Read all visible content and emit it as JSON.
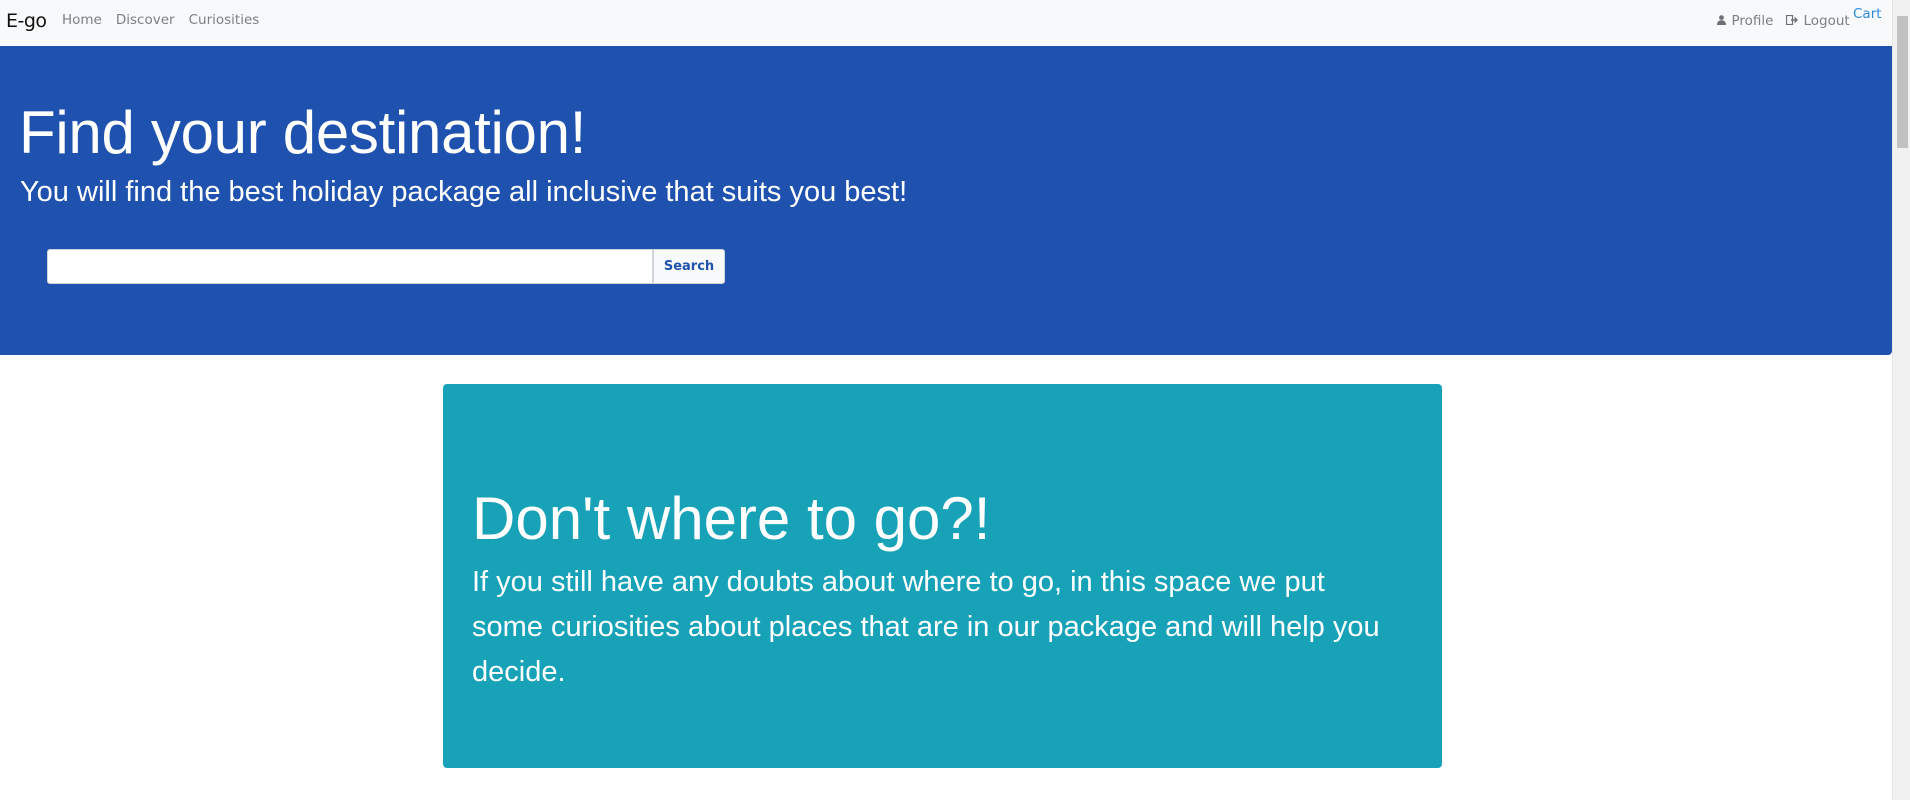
{
  "navbar": {
    "brand": "E-go",
    "links": [
      "Home",
      "Discover",
      "Curiosities"
    ],
    "profile_label": "Profile",
    "logout_label": "Logout",
    "cart_label": "Cart",
    "profile_icon": "user-icon",
    "logout_icon": "sign-out-icon"
  },
  "hero": {
    "title": "Find your destination!",
    "subtitle": "You will find the best holiday package all inclusive that suits you best!",
    "search": {
      "value": "",
      "placeholder": "",
      "button_label": "Search"
    },
    "background_color": "#1e52ae"
  },
  "card": {
    "title": "Don't where to go?!",
    "text": "If you still have any doubts about where to go, in this space we put some curiosities about places that are in our package and will help you decide.",
    "background_color": "#17a2b8"
  }
}
